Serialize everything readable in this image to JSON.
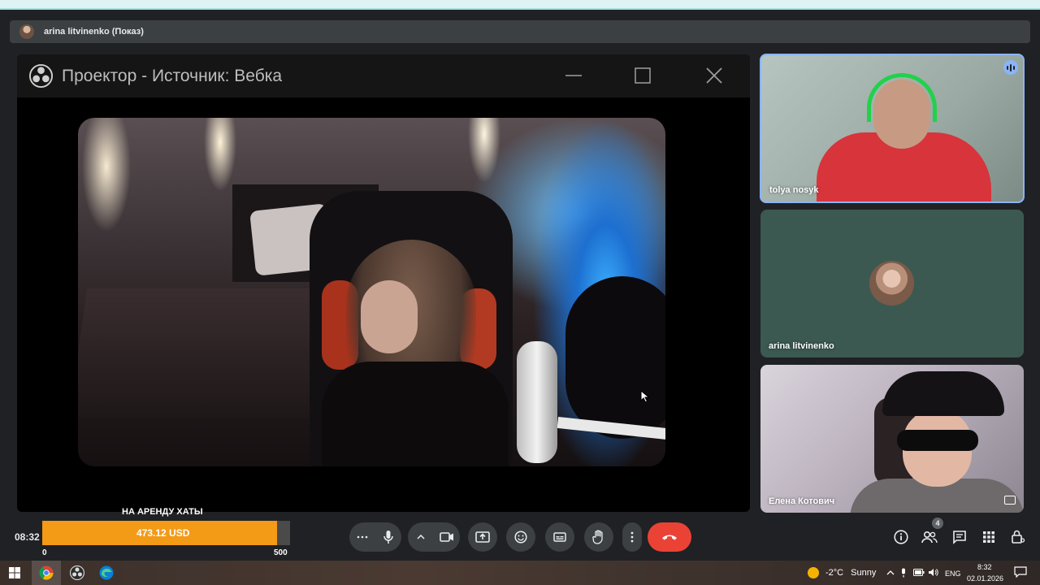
{
  "presenter": {
    "name": "arina litvinenko (Показ)"
  },
  "projector": {
    "title": "Проектор - Источник: Вебка"
  },
  "participants": [
    {
      "name": "tolya nosyk",
      "speaking": true
    },
    {
      "name": "arina litvinenko"
    },
    {
      "name": "Елена Котович"
    }
  ],
  "meeting": {
    "time": "08:32",
    "people_count": "4"
  },
  "goal": {
    "label": "НА АРЕНДУ ХАТЫ",
    "amount": "473.12 USD",
    "min": "0",
    "max": "500",
    "progress": 0.946,
    "color": "#f39a17"
  },
  "controls": {
    "leave_color": "#ea4335",
    "active_border": "#8ab4f8"
  },
  "taskbar": {
    "weather_temp": "-2°C",
    "weather_cond": "Sunny",
    "lang": "ENG",
    "clock_time": "8:32",
    "clock_date": "02.01.2026"
  }
}
